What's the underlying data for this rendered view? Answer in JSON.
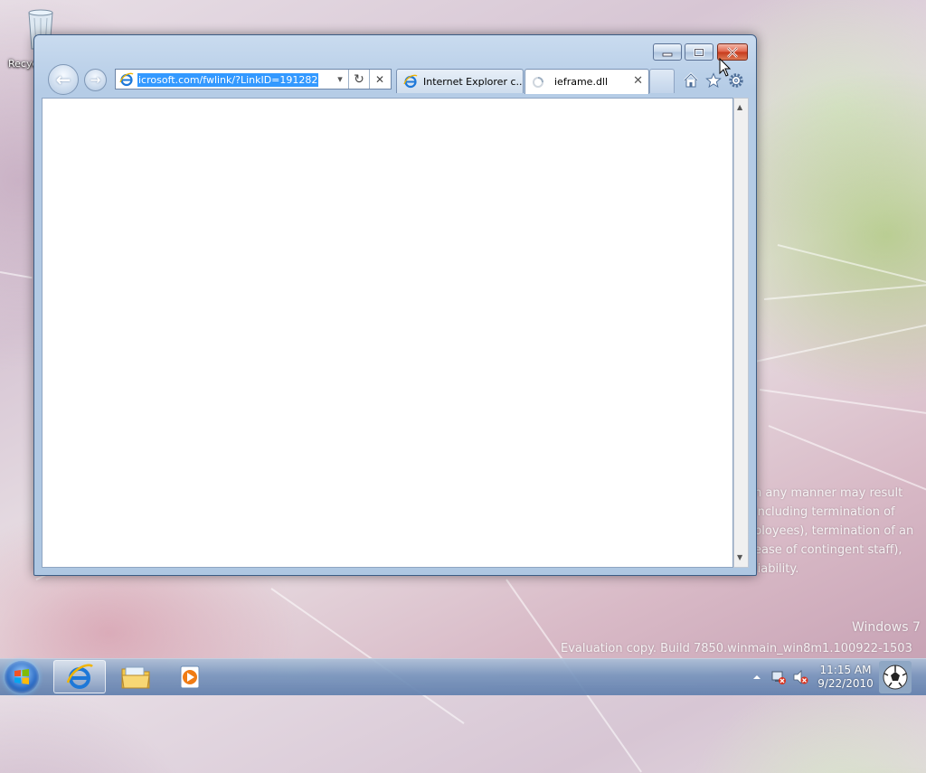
{
  "desktop": {
    "recycle_bin_label": "Recyc",
    "watermark_lines": [
      "n any manner may result",
      "including termination of",
      "ployees), termination of an",
      "ease of contingent staff),",
      "liability."
    ],
    "os_name": "Windows 7",
    "build_text": "Evaluation copy. Build 7850.winmain_win8m1.100922-1503"
  },
  "browser": {
    "address_url": "icrosoft.com/fwlink/?LinkID=191282",
    "tabs": [
      {
        "label": "Internet Explorer c...",
        "active": false,
        "icon": "ie-icon"
      },
      {
        "label": "ieframe.dll",
        "active": true,
        "icon": "loading-icon",
        "close": "✕"
      }
    ],
    "refresh_glyph": "↻",
    "stop_glyph": "✕",
    "dropdown_glyph": "▾",
    "back_glyph": "←",
    "forward_glyph": "→"
  },
  "taskbar": {
    "time": "11:15 AM",
    "date": "9/22/2010",
    "pinned": [
      "internet-explorer",
      "windows-explorer",
      "media-player"
    ]
  },
  "colors": {
    "selection": "#3399ff",
    "close_button": "#c63a1c",
    "window_frame": "#b5cce6"
  }
}
